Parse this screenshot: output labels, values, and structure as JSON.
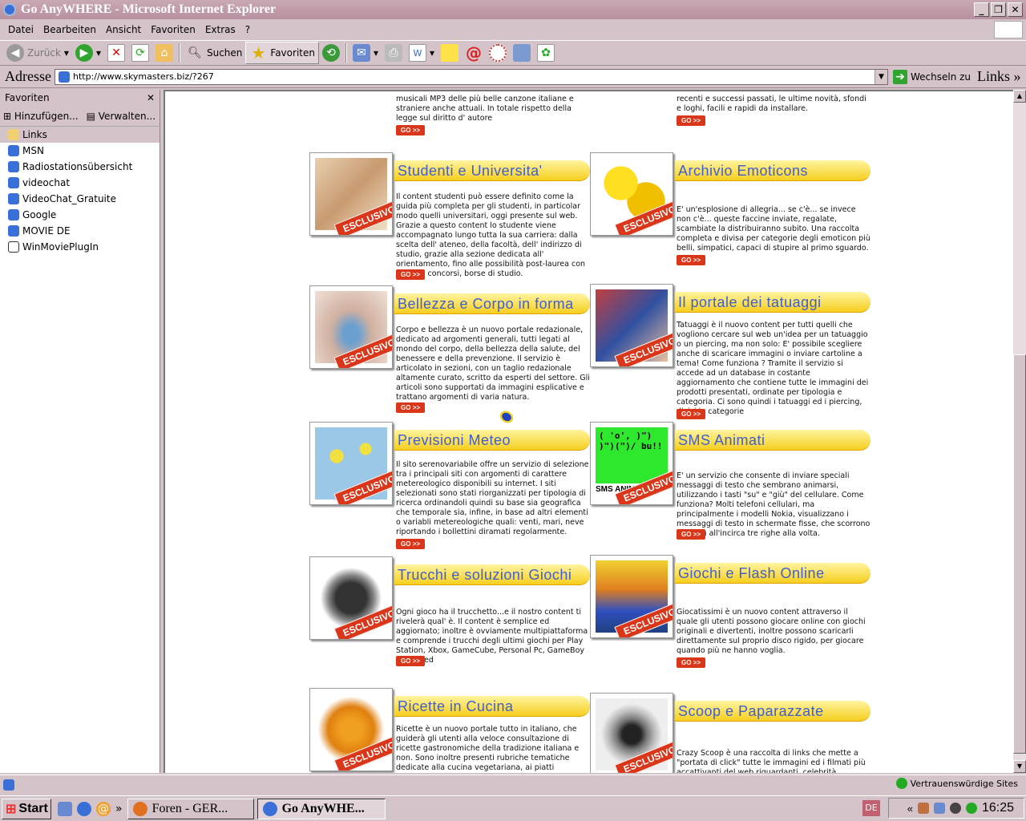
{
  "window": {
    "title": "Go AnyWHERE - Microsoft Internet Explorer"
  },
  "menu": [
    "Datei",
    "Bearbeiten",
    "Ansicht",
    "Favoriten",
    "Extras",
    "?"
  ],
  "toolbar": {
    "back": "Zurück",
    "search": "Suchen",
    "favorites": "Favoriten"
  },
  "address": {
    "label": "Adresse",
    "url": "http://www.skymasters.biz/?267",
    "go": "Wechseln zu",
    "links": "Links"
  },
  "favorites": {
    "title": "Favoriten",
    "add": "Hinzufügen...",
    "manage": "Verwalten...",
    "items": [
      "Links",
      "MSN",
      "Radiostationsübersicht",
      "videochat",
      "VideoChat_Gratuite",
      "Google",
      "MOVIE DE",
      "WinMoviePlugIn"
    ]
  },
  "page": {
    "badge": "ESCLUSIVO",
    "go": "GO >>",
    "top_left_text": "musicali MP3 delle più belle canzone italiane e straniere anche attuali. In totale rispetto della legge sul diritto d' autore",
    "top_right_text": "recenti e successi passati, le ultime novità, sfondi e loghi, facili e rapidi da installare.",
    "cards": [
      {
        "title": "Studenti e Universita'",
        "text": "Il content studenti può essere definito come la guida più completa per gli studenti, in particolar modo quelli universitari, oggi presente sul web. Grazie a questo content lo studente viene accompagnato lungo tutta la sua carriera: dalla scelta dell' ateneo, della facoltà, dell' indirizzo di studio, grazie alla sezione dedicata all' orientamento, fino alle possibilità post-laurea con master, concorsi, borse di studio."
      },
      {
        "title": "Archivio Emoticons",
        "text": "E' un'esplosione di allegria... se c'è... se invece non c'è... queste faccine inviate, regalate, scambiate la distribuiranno subito. Una raccolta completa e divisa per categorie degli emoticon più belli, simpatici, capaci di stupire al primo sguardo."
      },
      {
        "title": "Bellezza e Corpo in forma",
        "text": "Corpo e bellezza è un nuovo portale redazionale, dedicato ad argomenti generali, tutti legati al mondo del corpo, della bellezza della salute, del benessere e della prevenzione. Il servizio è articolato in sezioni, con un taglio redazionale altamente curato, scritto da esperti del settore. Gli articoli sono supportati da immagini esplicative e trattano argomenti di varia natura."
      },
      {
        "title": "Il portale dei tatuaggi",
        "text": "Tatuaggi è il nuovo content per tutti quelli che vogliono cercare sul web un'idea per un tatuaggio o un piercing, ma non solo: E' possibile scegliere anche di scaricare immagini o inviare cartoline a tema! Come funziona ? Tramite il servizio si accede ad un database in costante aggiornamento che contiene tutte le immagini dei prodotti presentati, ordinate per tipologia e categoria. Ci sono quindi i tatuaggi ed i piercing, divisi in categorie"
      },
      {
        "title": "Previsioni Meteo",
        "text": "Il sito serenovariabile offre un servizio di selezione tra i principali siti con argomenti di carattere metereologico disponibili su internet. I siti selezionati sono stati riorganizzati per tipologia di ricerca ordinandoli quindi su base sia geografica che temporale sia, infine, in base ad altri elementi o variabli metereologiche quali: venti, mari, neve riportando i bollettini diramati regolarmente."
      },
      {
        "title": "SMS Animati",
        "text": "E' un servizio che consente di inviare speciali messaggi di testo che sembrano animarsi, utilizzando i tasti \"su\" e \"giù\" del cellulare. Come funziona? Molti telefoni cellulari, ma principalmente i modelli Nokia, visualizzano i messaggi di testo in schermate fisse, che scorrono su e giù all'incirca tre righe alla volta.",
        "screen": "( 'o', )\")  )\")(\")/ bu!!",
        "label": "SMS ANIMAT"
      },
      {
        "title": "Trucchi e soluzioni Giochi",
        "text": "Ogni gioco ha il trucchetto...e il nostro content ti rivelerà qual' è. Il content è semplice ed aggiornato; inoltre è ovviamente multipiattaforma e comprende i trucchi degli ultimi giochi per Play Station, Xbox, GameCube, Personal Pc, GameBoy Advanced"
      },
      {
        "title": "Giochi e Flash Online",
        "text": "Giocatissimi è un nuovo content attraverso il quale gli utenti possono giocare online con giochi originali e divertenti, inoltre possono scaricarli direttamente sul proprio disco rigido, per giocare quando più ne hanno voglia."
      },
      {
        "title": "Ricette in Cucina",
        "text": "Ricette è un nuovo portale tutto in italiano, che guiderà gli utenti alla veloce consultazione di ricette gastronomiche della tradizione italiana e non. Sono inoltre presenti rubriche tematiche dedicate alla cucina vegetariana, ai piatti stagionali e tanto altro"
      },
      {
        "title": "Scoop e Paparazzate",
        "text": "Crazy Scoop è una raccolta di links che mette a \"portata di click\" tutte le immagini ed i filmati più accattivanti del web riguardanti, celebrità, cantanti e"
      }
    ]
  },
  "status": {
    "zone": "Vertrauenswürdige Sites"
  },
  "taskbar": {
    "start": "Start",
    "task1": "Foren - GER...",
    "task2": "Go AnyWHE...",
    "lang": "DE",
    "time": "16:25"
  },
  "colors": {
    "accent": "#d9361a",
    "title_blue": "#3f5fd0",
    "title_yellow": "#f6cf1f"
  }
}
